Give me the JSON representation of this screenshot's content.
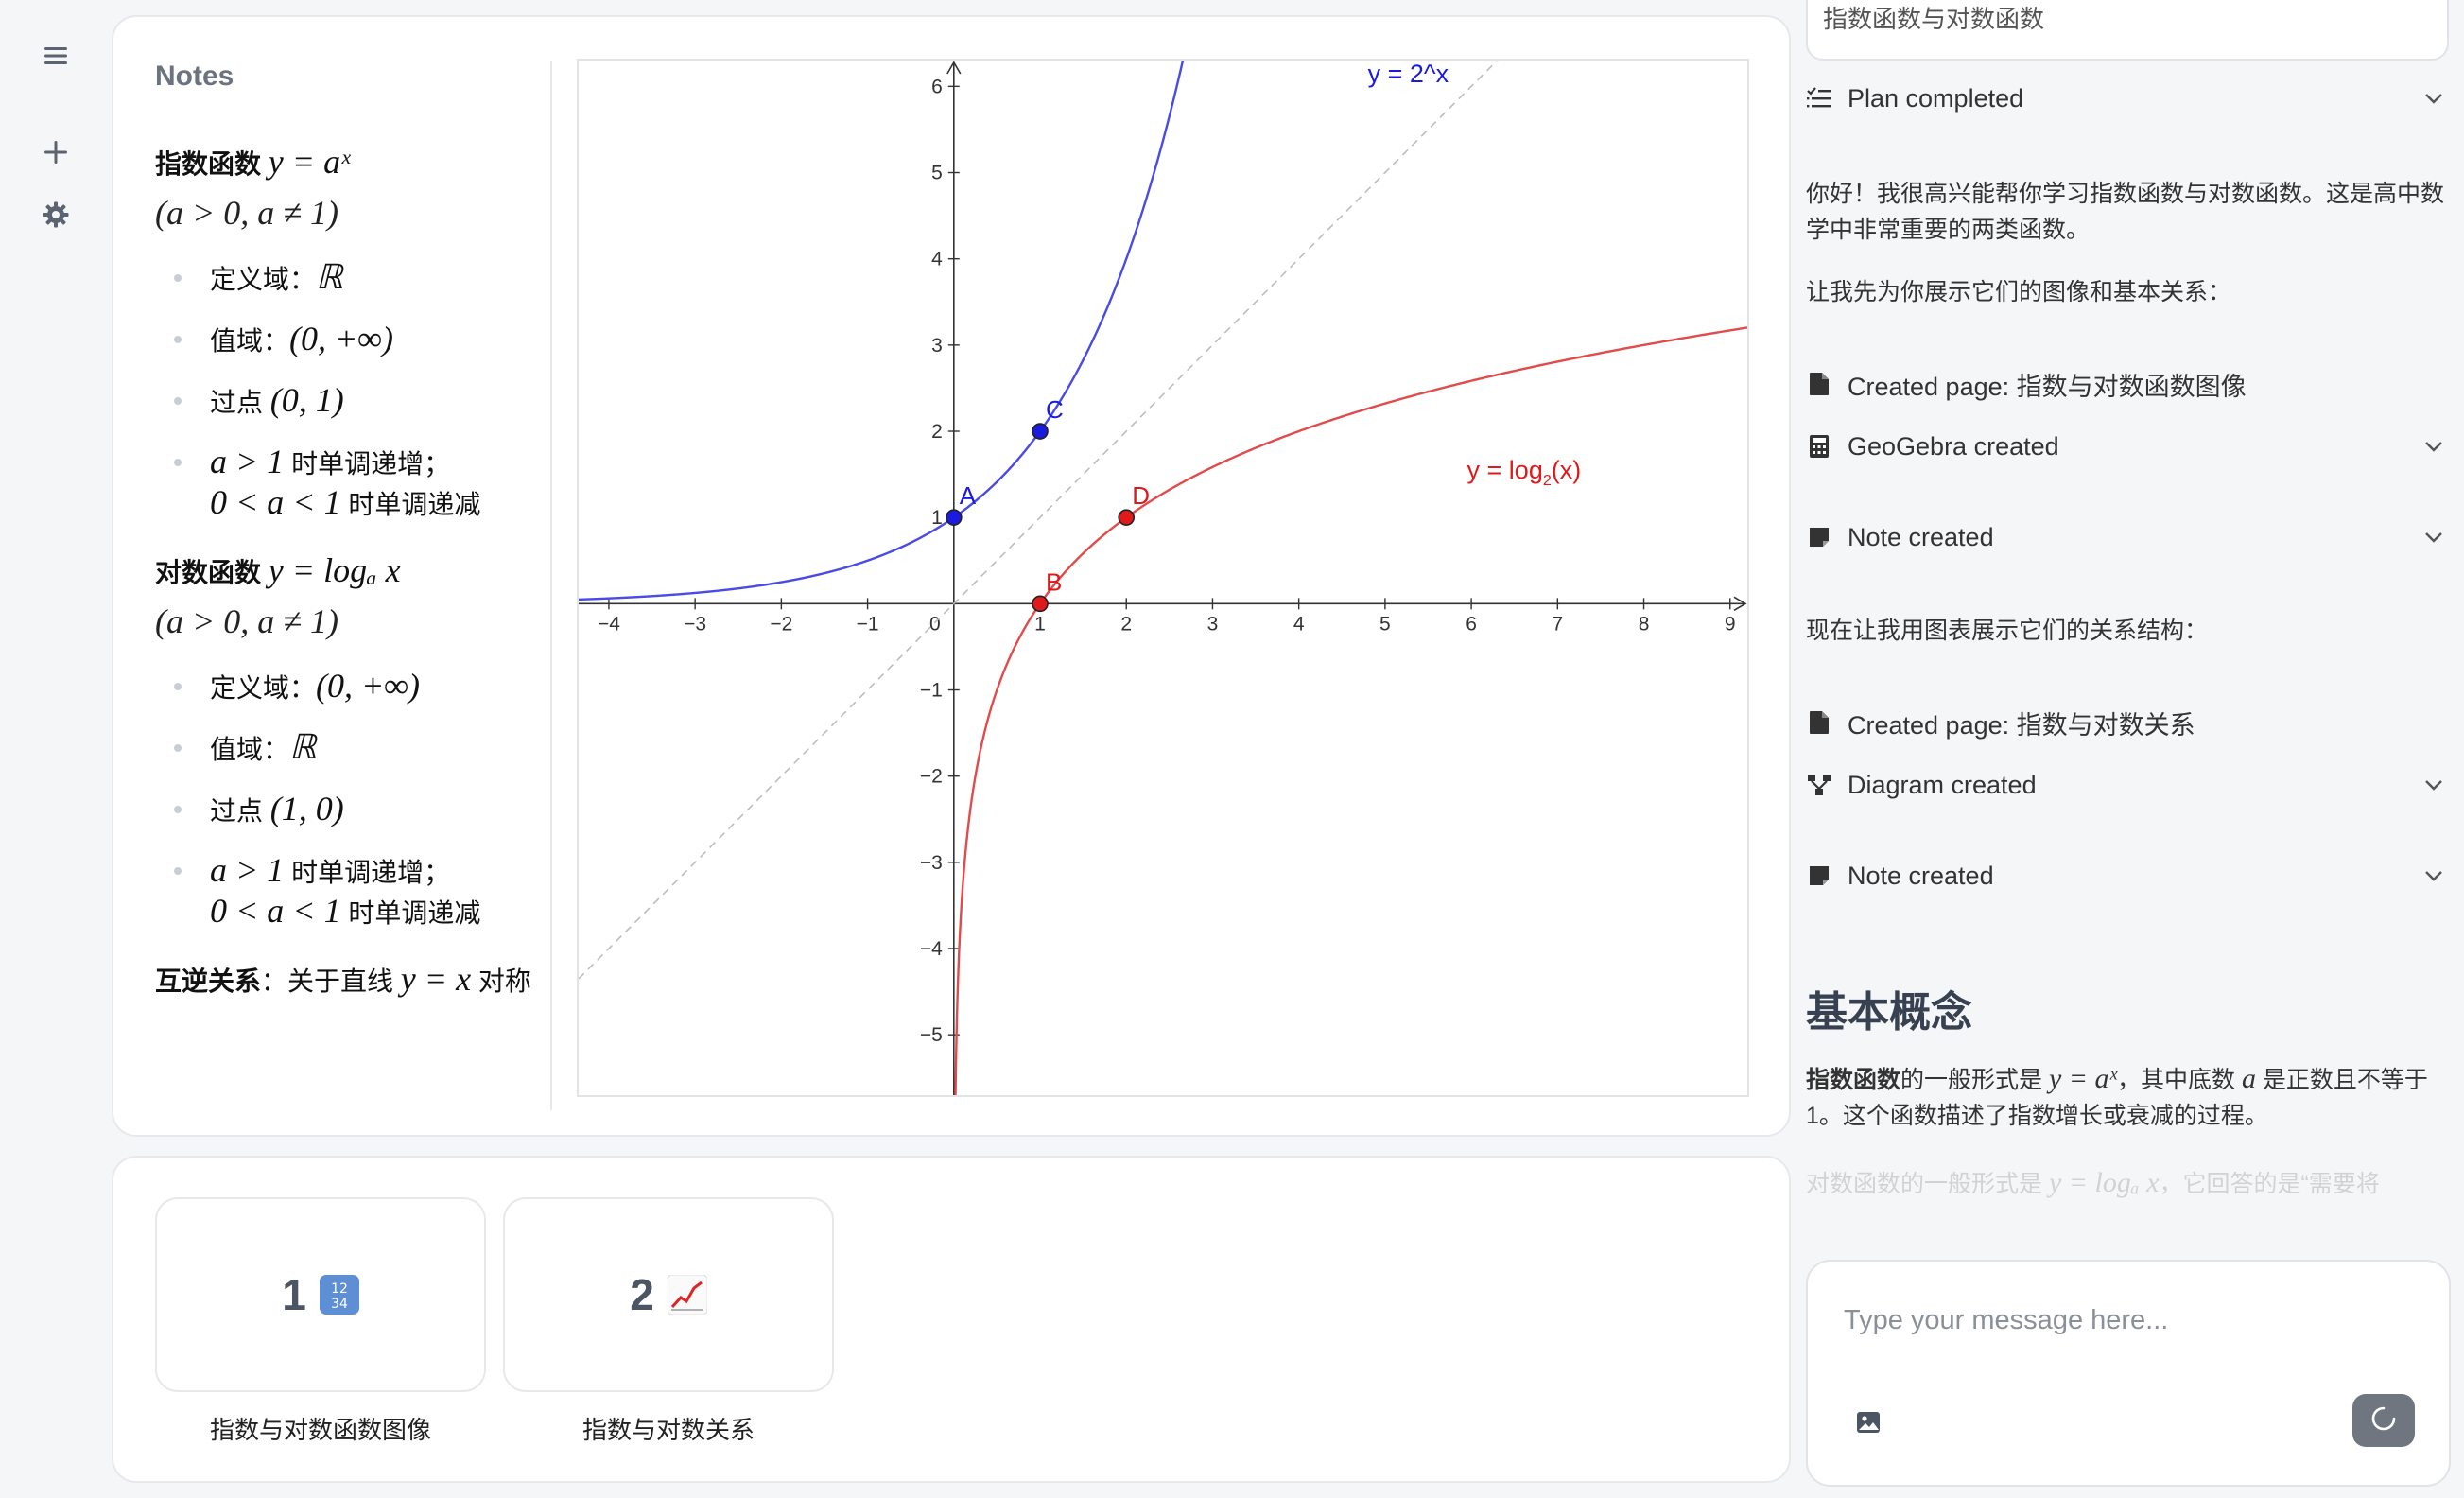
{
  "notes": {
    "title": "Notes",
    "exp": {
      "heading": "指数函数",
      "formula": "y = aˣ",
      "condition": "(a > 0, a ≠ 1)",
      "items": [
        {
          "label": "定义域：",
          "math": "ℝ"
        },
        {
          "label": "值域：",
          "math": "(0, +∞)"
        },
        {
          "label": "过点 ",
          "math": "(0, 1)"
        }
      ],
      "mono_line1_math": "a > 1",
      "mono_line1_text": " 时单调递增；",
      "mono_line2_math": "0 < a < 1",
      "mono_line2_text": " 时单调递减"
    },
    "log": {
      "heading": "对数函数",
      "formula": "y = logₐ x",
      "condition": "(a > 0, a ≠ 1)",
      "items": [
        {
          "label": "定义域：",
          "math": "(0, +∞)"
        },
        {
          "label": "值域：",
          "math": "ℝ"
        },
        {
          "label": "过点 ",
          "math": "(1, 0)"
        }
      ],
      "mono_line1_math": "a > 1",
      "mono_line1_text": " 时单调递增；",
      "mono_line2_math": "0 < a < 1",
      "mono_line2_text": " 时单调递减"
    },
    "relation": {
      "label": "互逆关系",
      "text1": "：关于直线 ",
      "math": "y = x",
      "text2": " 对称"
    }
  },
  "chart_data": {
    "type": "line",
    "xlim": [
      -4.35,
      9.2
    ],
    "ylim": [
      -5.7,
      6.3
    ],
    "x_ticks": [
      -4,
      -3,
      -2,
      -1,
      0,
      1,
      2,
      3,
      4,
      5,
      6,
      7,
      8,
      9
    ],
    "y_ticks": [
      -5,
      -4,
      -3,
      -2,
      -1,
      1,
      2,
      3,
      4,
      5,
      6
    ],
    "series": [
      {
        "name": "y = 2^x",
        "function": "2^x",
        "color": "#4a4ae6"
      },
      {
        "name": "y = log2(x)",
        "function": "log2(x)",
        "color": "#e24b4b"
      },
      {
        "name": "",
        "function": "x",
        "color": "#bdbdbd",
        "dashed": true
      }
    ],
    "points": [
      {
        "label": "A",
        "x": 0,
        "y": 1,
        "color": "#1a1ae0"
      },
      {
        "label": "C",
        "x": 1,
        "y": 2,
        "color": "#1a1ae0"
      },
      {
        "label": "B",
        "x": 1,
        "y": 0,
        "color": "#e01a1a"
      },
      {
        "label": "D",
        "x": 2,
        "y": 1,
        "color": "#e01a1a"
      }
    ],
    "labels": {
      "exp": "y = 2^x",
      "log_prefix": "y = log",
      "log_sub": "2",
      "log_suffix": "(x)"
    }
  },
  "pages": [
    {
      "num": "1",
      "icon": "input-numbers-icon",
      "label": "指数与对数函数图像"
    },
    {
      "num": "2",
      "icon": "chart-increasing-icon",
      "label": "指数与对数关系"
    }
  ],
  "chat": {
    "top_input_value": "指数函数与对数函数",
    "plan": "Plan completed",
    "p1": "你好！我很高兴能帮你学习指数函数与对数函数。这是高中数学中非常重要的两类函数。",
    "p2": "让我先为你展示它们的图像和基本关系：",
    "created_page_1": "Created page: 指数与对数函数图像",
    "geogebra": "GeoGebra created",
    "note_1": "Note created",
    "p3": "现在让我用图表展示它们的关系结构：",
    "created_page_2": "Created page: 指数与对数关系",
    "diagram": "Diagram created",
    "note_2": "Note created",
    "h2": "基本概念",
    "p4_bold": "指数函数",
    "p4_a": "的一般形式是 ",
    "p4_m1": "y = aˣ",
    "p4_b": "，其中底数 ",
    "p4_m2": "a",
    "p4_c": " 是正数且不等于1。这个函数描述了指数增长或衰减的过程。",
    "p5_a": "对数函数的一般形式是 ",
    "p5_m": "y = logₐ x",
    "p5_b": "，它回答的是“需要将",
    "composer_placeholder": "Type your message here..."
  }
}
